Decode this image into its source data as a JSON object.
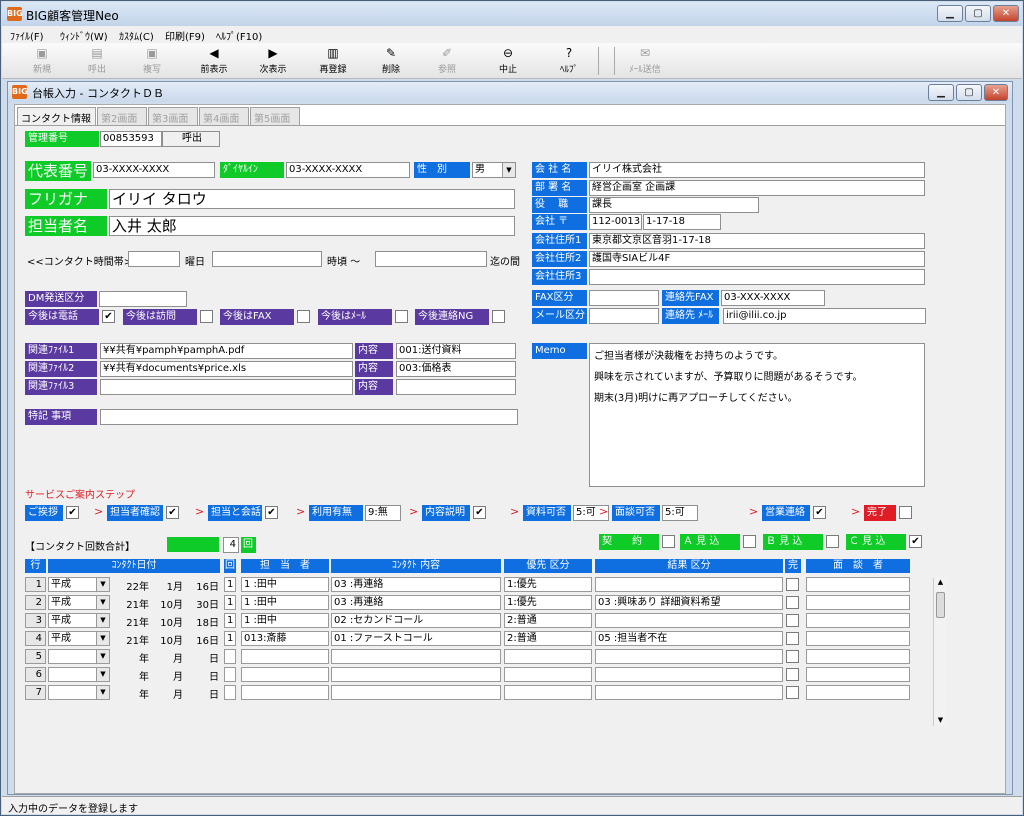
{
  "app": {
    "title": "BIG顧客管理Neo",
    "icon_text": "BIG"
  },
  "menu": [
    "ﾌｧｲﾙ(F)",
    "ｳｨﾝﾄﾞｳ(W)",
    "ｶｽﾀﾑ(C)",
    "印刷(F9)",
    "ﾍﾙﾌﾟ(F10)"
  ],
  "toolbar": [
    {
      "label": "新規",
      "icon": "new-icon",
      "glyph": "▣",
      "enabled": false
    },
    {
      "label": "呼出",
      "icon": "folder-icon",
      "glyph": "▤",
      "enabled": false
    },
    {
      "label": "複写",
      "icon": "copy-icon",
      "glyph": "▣",
      "enabled": false
    },
    {
      "label": "前表示",
      "icon": "prev-icon",
      "glyph": "◀",
      "enabled": true
    },
    {
      "label": "次表示",
      "icon": "next-icon",
      "glyph": "▶",
      "enabled": true
    },
    {
      "label": "再登録",
      "icon": "save-icon",
      "glyph": "▥",
      "enabled": true
    },
    {
      "label": "削除",
      "icon": "delete-icon",
      "glyph": "✎",
      "enabled": true
    },
    {
      "label": "参照",
      "icon": "refer-icon",
      "glyph": "✐",
      "enabled": false
    },
    {
      "label": "中止",
      "icon": "stop-icon",
      "glyph": "⊖",
      "enabled": true
    },
    {
      "label": "ﾍﾙﾌﾟ",
      "icon": "help-icon",
      "glyph": "?",
      "enabled": true
    },
    {
      "label": "ﾒｰﾙ送信",
      "icon": "mail-icon",
      "glyph": "✉",
      "enabled": false
    }
  ],
  "child": {
    "title": "台帳入力 - コンタクトＤＢ"
  },
  "tabs": [
    "コンタクト情報",
    "第2画面",
    "第3画面",
    "第4画面",
    "第5画面"
  ],
  "form": {
    "kanri_label": "管理番号",
    "kanri_value": "00853593",
    "yobidashi": "呼出",
    "daihyo_label": "代表番号",
    "daihyo_value": "03-XXXX-XXXX",
    "dial_label": "ﾀﾞｲﾔﾙｲﾝ",
    "dial_value": "03-XXXX-XXXX",
    "seibetsu_label": "性　別",
    "seibetsu_value": "男",
    "furigana_label": "フリガナ",
    "furigana_value": "イリイ タロウ",
    "tanto_label": "担当者名",
    "tanto_value": "入井 太郎",
    "contact_time": "<<コンタクト時間帯>>",
    "youbi": "曜日",
    "jigoro": "時頃 ～",
    "made": "迄の間",
    "dm_label": "DM発送区分",
    "flags": [
      {
        "label": "今後は電話",
        "checked": true
      },
      {
        "label": "今後は訪問",
        "checked": false
      },
      {
        "label": "今後はFAX",
        "checked": false
      },
      {
        "label": "今後はﾒｰﾙ",
        "checked": false
      },
      {
        "label": "今後連絡NG",
        "checked": false
      }
    ],
    "files": [
      {
        "label": "関連ﾌｧｲﾙ1",
        "path": "¥¥共有¥pamph¥pamphA.pdf",
        "nai_label": "内容",
        "nai": "001:送付資料"
      },
      {
        "label": "関連ﾌｧｲﾙ2",
        "path": "¥¥共有¥documents¥price.xls",
        "nai_label": "内容",
        "nai": "003:価格表"
      },
      {
        "label": "関連ﾌｧｲﾙ3",
        "path": "",
        "nai_label": "内容",
        "nai": ""
      }
    ],
    "tokki_label": "特記 事項",
    "company": [
      {
        "label": "会 社 名",
        "value": "イリイ株式会社"
      },
      {
        "label": "部 署 名",
        "value": "経営企画室 企画課"
      },
      {
        "label": "役　 職",
        "value": "課長"
      }
    ],
    "zip_label": "会社 〒",
    "zip1": "112-0013",
    "zip2": "1-17-18",
    "addr": [
      {
        "label": "会社住所1",
        "value": "東京都文京区音羽1-17-18"
      },
      {
        "label": "会社住所2",
        "value": "護国寺SIAビル4F"
      },
      {
        "label": "会社住所3",
        "value": ""
      }
    ],
    "fax_kubun": "FAX区分",
    "renraku_fax_label": "連絡先FAX",
    "renraku_fax": "03-XXX-XXXX",
    "mail_kubun": "メール区分",
    "renraku_mail_label": "連絡先 ﾒｰﾙ",
    "renraku_mail": "irii@ilii.co.jp",
    "memo_label": "Memo",
    "memo_lines": [
      "ご担当者様が決裁権をお持ちのようです。",
      "興味を示されていますが、予算取りに問題があるそうです。",
      "期末(3月)明けに再アプローチしてください。"
    ],
    "steps_title": "サービスご案内ステップ",
    "steps": [
      {
        "label": "ご挨拶",
        "checked": true,
        "value": null
      },
      {
        "label": "担当者確認",
        "checked": true,
        "value": null
      },
      {
        "label": "担当と会話",
        "checked": true,
        "value": null
      },
      {
        "label": "利用有無",
        "checked": null,
        "value": "9:無"
      },
      {
        "label": "内容説明",
        "checked": true,
        "value": null
      },
      {
        "label": "資料可否",
        "checked": null,
        "value": "5:可"
      },
      {
        "label": "面談可否",
        "checked": null,
        "value": "5:可"
      },
      {
        "label": "営業連絡",
        "checked": true,
        "value": null
      },
      {
        "label": "完了",
        "checked": false,
        "value": null
      }
    ],
    "count_label": "【コンタクト回数合計】",
    "count_value": "4",
    "count_unit": "回",
    "mikomi": [
      {
        "label": "契　　約",
        "checked": false
      },
      {
        "label": "Ａ 見 込",
        "checked": false
      },
      {
        "label": "Ｂ 見 込",
        "checked": false
      },
      {
        "label": "Ｃ 見 込",
        "checked": true
      }
    ]
  },
  "table": {
    "headers": [
      "行",
      "ｺﾝﾀｸﾄ日付",
      "回",
      "担　当　者",
      "ｺﾝﾀｸﾄ 内容",
      "優先 区分",
      "結果 区分",
      "完",
      "面　談　者"
    ],
    "rows": [
      {
        "n": "1",
        "era": "平成",
        "y": "22年",
        "m": "1月",
        "d": "16日",
        "kai": "1",
        "tanto": "1 :田中",
        "naiyo": "03 :再連絡",
        "yusen": "1:優先",
        "kekka": "",
        "kan": false,
        "mendan": ""
      },
      {
        "n": "2",
        "era": "平成",
        "y": "21年",
        "m": "10月",
        "d": "30日",
        "kai": "1",
        "tanto": "1 :田中",
        "naiyo": "03 :再連絡",
        "yusen": "1:優先",
        "kekka": "03 :興味あり 詳細資料希望",
        "kan": false,
        "mendan": ""
      },
      {
        "n": "3",
        "era": "平成",
        "y": "21年",
        "m": "10月",
        "d": "18日",
        "kai": "1",
        "tanto": "1 :田中",
        "naiyo": "02 :セカンドコール",
        "yusen": "2:普通",
        "kekka": "",
        "kan": false,
        "mendan": ""
      },
      {
        "n": "4",
        "era": "平成",
        "y": "21年",
        "m": "10月",
        "d": "16日",
        "kai": "1",
        "tanto": "013:斎藤",
        "naiyo": "01 :ファーストコール",
        "yusen": "2:普通",
        "kekka": "05 :担当者不在",
        "kan": false,
        "mendan": ""
      },
      {
        "n": "5",
        "era": "",
        "y": "年",
        "m": "月",
        "d": "日",
        "kai": "",
        "tanto": "",
        "naiyo": "",
        "yusen": "",
        "kekka": "",
        "kan": false,
        "mendan": ""
      },
      {
        "n": "6",
        "era": "",
        "y": "年",
        "m": "月",
        "d": "日",
        "kai": "",
        "tanto": "",
        "naiyo": "",
        "yusen": "",
        "kekka": "",
        "kan": false,
        "mendan": ""
      },
      {
        "n": "7",
        "era": "",
        "y": "年",
        "m": "月",
        "d": "日",
        "kai": "",
        "tanto": "",
        "naiyo": "",
        "yusen": "",
        "kekka": "",
        "kan": false,
        "mendan": ""
      }
    ]
  },
  "status": "入力中のデータを登録します"
}
